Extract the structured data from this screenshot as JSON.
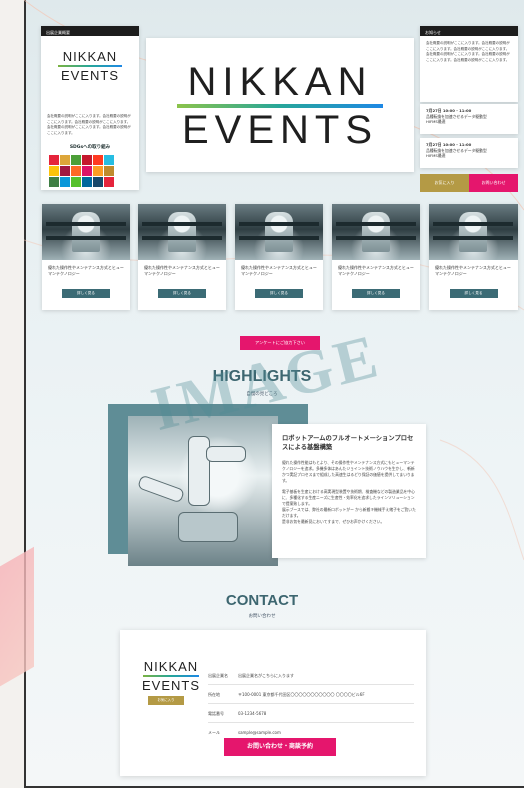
{
  "left_panel": {
    "header": "出展企業概要",
    "logo_line1": "NIKKAN",
    "logo_line2": "EVENTS",
    "description": "会社概要の説明がここに入ります。会社概要の説明がここに入ります。会社概要の説明がここに入ります。会社概要の説明がここに入ります。会社概要の説明がここに入ります。",
    "sdg_title": "SDGsへの取り組み",
    "sdg_colors": [
      "#e5243b",
      "#dda63a",
      "#4c9f38",
      "#c5192d",
      "#ff3a21",
      "#26bde2",
      "#fcc30b",
      "#a21942",
      "#fd6925",
      "#dd1367",
      "#fd9d24",
      "#bf8b2e",
      "#3f7e44",
      "#0a97d9",
      "#56c02b",
      "#00689d",
      "#19486a",
      "#e5243b"
    ]
  },
  "main_logo": {
    "line1": "NIKKAN",
    "line2": "EVENTS"
  },
  "right_panel": {
    "header": "お知らせ",
    "description": "会社概要の説明がここに入ります。会社概要の説明がここに入ります。会社概要の説明がここに入ります。会社概要の説明がここに入ります。会社概要の説明がここに入ります。会社概要の説明がここに入ります。",
    "news": [
      {
        "date": "7月27日 10:00 - 11:00",
        "line1": "品種転換を加速させるデータ駆動型",
        "line2": "HIFMS最適"
      },
      {
        "date": "7月27日 10:00 - 11:00",
        "line1": "品種転換を加速させるデータ駆動型",
        "line2": "HIFMS最適"
      }
    ],
    "btn_favorite": "お気に入り",
    "btn_contact": "お問い合わせ"
  },
  "products": [
    {
      "title": "優れた操作性やメンテナンス方式とヒューマンテクノロジー",
      "button": "詳しく見る"
    },
    {
      "title": "優れた操作性やメンテナンス方式とヒューマンテクノロジー",
      "button": "詳しく見る"
    },
    {
      "title": "優れた操作性やメンテナンス方式とヒューマンテクノロジー",
      "button": "詳しく見る"
    },
    {
      "title": "優れた操作性やメンテナンス方式とヒューマンテクノロジー",
      "button": "詳しく見る"
    },
    {
      "title": "優れた操作性やメンテナンス方式とヒューマンテクノロジー",
      "button": "詳しく見る"
    }
  ],
  "cta": {
    "label": "アンケートにご協力下さい"
  },
  "highlights": {
    "title": "HIGHLIGHTS",
    "subtitle": "自慢の見どころ",
    "watermark": "IMAGE",
    "heading": "ロボットアームのフルオートメーションプロセスによる基盤構築",
    "para1": "優れた操作性能はもとより、その操作性やメンテナンス方式にもヒューマンテクノロジーを追求。多機多体はあんたジョイント技術ノウハウを生かし、斬新かつ実記プロセスまで組成した高速生はるどり保証の価値を提供してまいります。",
    "para2": "電子基板を生産における高実現型装置や技術期、検査機などの製造業品を中心に、多種化する生産ニーズに生産性・効率化を追求したラインソリューションで提案致します。",
    "para3": "展示ブースでは、弊社の最新ロボットがー から新搬キ機械手え緒子をご覧いただけます。",
    "para4": "是非お気を最新見においてすまで、ぜひお声かけください。"
  },
  "contact": {
    "title": "CONTACT",
    "subtitle": "お問い合わせ",
    "logo_line1": "NIKKAN",
    "logo_line2": "EVENTS",
    "small_button": "お気に入り",
    "rows": [
      {
        "label": "出展企業名",
        "value": "出展企業名がこちらに入ります"
      },
      {
        "label": "所在地",
        "value": "〒100-0001 東京都千代田区〇〇〇〇〇〇〇〇〇〇〇 〇〇〇〇ビル6F"
      },
      {
        "label": "電話番号",
        "value": "03-1234-5678"
      },
      {
        "label": "メール",
        "value": "sample@sample.com"
      }
    ],
    "big_button": "お問い合わせ・商談予約"
  }
}
